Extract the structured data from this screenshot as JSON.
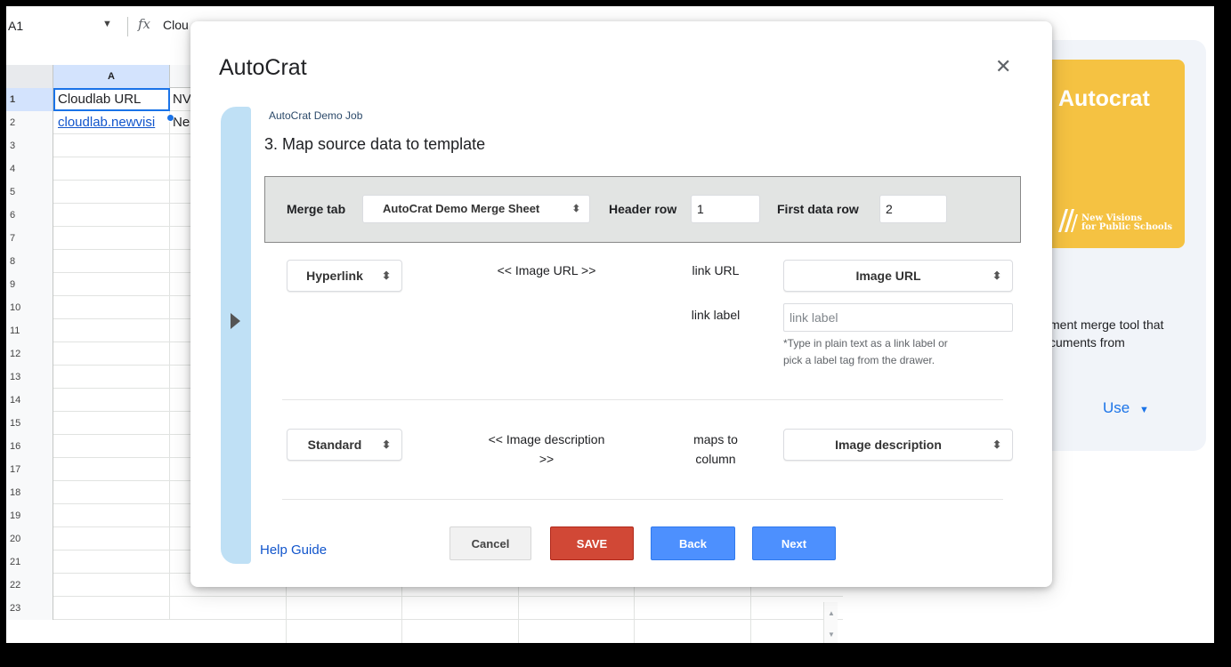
{
  "spreadsheet": {
    "name_box": "A1",
    "formula_text": "Clou",
    "column_a_header": "A",
    "row_numbers": [
      "1",
      "2",
      "3",
      "4",
      "5",
      "6",
      "7",
      "8",
      "9",
      "10",
      "11",
      "12",
      "13",
      "14",
      "15",
      "16",
      "17",
      "18",
      "19",
      "20",
      "21",
      "22",
      "23"
    ],
    "cells": {
      "a1": "Cloudlab URL",
      "b1": "NV",
      "a2": "cloudlab.newvisi",
      "b2": "Ne"
    }
  },
  "sidebar": {
    "brand_title": "Autocrat",
    "brand_org_line1": "New Visions",
    "brand_org_line2": "for Public Schools",
    "desc_line1": "ment merge tool that",
    "desc_line2": "cuments from",
    "use_label": "Use"
  },
  "modal": {
    "title": "AutoCrat",
    "job_name": "AutoCrat Demo Job",
    "step_title": "3. Map source data to template",
    "merge_bar": {
      "merge_tab_label": "Merge tab",
      "merge_tab_value": "AutoCrat Demo Merge Sheet",
      "header_row_label": "Header row",
      "header_row_value": "1",
      "first_data_row_label": "First data row",
      "first_data_row_value": "2"
    },
    "mappings": [
      {
        "type": "Hyperlink",
        "tag": "<< Image URL >>",
        "field1_label": "link URL",
        "field1_value": "Image URL",
        "field2_label": "link label",
        "field2_placeholder": "link label",
        "hint_line1": "*Type in plain text as a link label or",
        "hint_line2": "pick a label tag from the drawer."
      },
      {
        "type": "Standard",
        "tag_line1": "<< Image description",
        "tag_line2": ">>",
        "field_label_line1": "maps to",
        "field_label_line2": "column",
        "field_value": "Image description"
      }
    ],
    "help_guide": "Help Guide",
    "buttons": {
      "cancel": "Cancel",
      "save": "SAVE",
      "back": "Back",
      "next": "Next"
    }
  },
  "colors": {
    "save": "#d14836",
    "primary": "#4d90fe",
    "brand_yellow": "#f5c242",
    "drawer": "#bfe0f5"
  }
}
